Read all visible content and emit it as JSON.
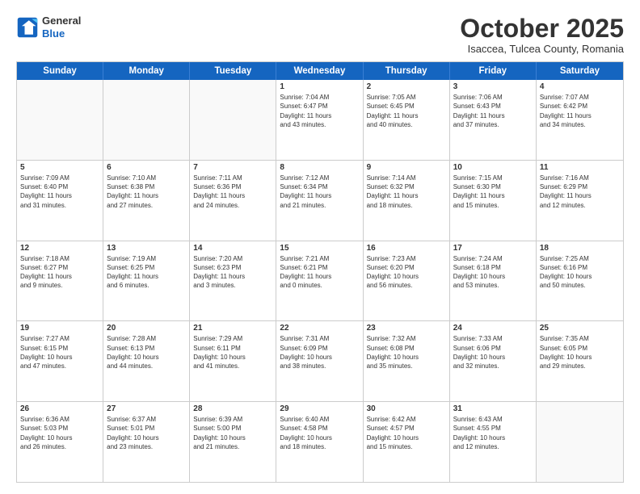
{
  "logo": {
    "general": "General",
    "blue": "Blue"
  },
  "header": {
    "month": "October 2025",
    "location": "Isaccea, Tulcea County, Romania"
  },
  "weekdays": [
    "Sunday",
    "Monday",
    "Tuesday",
    "Wednesday",
    "Thursday",
    "Friday",
    "Saturday"
  ],
  "weeks": [
    [
      {
        "day": "",
        "info": ""
      },
      {
        "day": "",
        "info": ""
      },
      {
        "day": "",
        "info": ""
      },
      {
        "day": "1",
        "info": "Sunrise: 7:04 AM\nSunset: 6:47 PM\nDaylight: 11 hours\nand 43 minutes."
      },
      {
        "day": "2",
        "info": "Sunrise: 7:05 AM\nSunset: 6:45 PM\nDaylight: 11 hours\nand 40 minutes."
      },
      {
        "day": "3",
        "info": "Sunrise: 7:06 AM\nSunset: 6:43 PM\nDaylight: 11 hours\nand 37 minutes."
      },
      {
        "day": "4",
        "info": "Sunrise: 7:07 AM\nSunset: 6:42 PM\nDaylight: 11 hours\nand 34 minutes."
      }
    ],
    [
      {
        "day": "5",
        "info": "Sunrise: 7:09 AM\nSunset: 6:40 PM\nDaylight: 11 hours\nand 31 minutes."
      },
      {
        "day": "6",
        "info": "Sunrise: 7:10 AM\nSunset: 6:38 PM\nDaylight: 11 hours\nand 27 minutes."
      },
      {
        "day": "7",
        "info": "Sunrise: 7:11 AM\nSunset: 6:36 PM\nDaylight: 11 hours\nand 24 minutes."
      },
      {
        "day": "8",
        "info": "Sunrise: 7:12 AM\nSunset: 6:34 PM\nDaylight: 11 hours\nand 21 minutes."
      },
      {
        "day": "9",
        "info": "Sunrise: 7:14 AM\nSunset: 6:32 PM\nDaylight: 11 hours\nand 18 minutes."
      },
      {
        "day": "10",
        "info": "Sunrise: 7:15 AM\nSunset: 6:30 PM\nDaylight: 11 hours\nand 15 minutes."
      },
      {
        "day": "11",
        "info": "Sunrise: 7:16 AM\nSunset: 6:29 PM\nDaylight: 11 hours\nand 12 minutes."
      }
    ],
    [
      {
        "day": "12",
        "info": "Sunrise: 7:18 AM\nSunset: 6:27 PM\nDaylight: 11 hours\nand 9 minutes."
      },
      {
        "day": "13",
        "info": "Sunrise: 7:19 AM\nSunset: 6:25 PM\nDaylight: 11 hours\nand 6 minutes."
      },
      {
        "day": "14",
        "info": "Sunrise: 7:20 AM\nSunset: 6:23 PM\nDaylight: 11 hours\nand 3 minutes."
      },
      {
        "day": "15",
        "info": "Sunrise: 7:21 AM\nSunset: 6:21 PM\nDaylight: 11 hours\nand 0 minutes."
      },
      {
        "day": "16",
        "info": "Sunrise: 7:23 AM\nSunset: 6:20 PM\nDaylight: 10 hours\nand 56 minutes."
      },
      {
        "day": "17",
        "info": "Sunrise: 7:24 AM\nSunset: 6:18 PM\nDaylight: 10 hours\nand 53 minutes."
      },
      {
        "day": "18",
        "info": "Sunrise: 7:25 AM\nSunset: 6:16 PM\nDaylight: 10 hours\nand 50 minutes."
      }
    ],
    [
      {
        "day": "19",
        "info": "Sunrise: 7:27 AM\nSunset: 6:15 PM\nDaylight: 10 hours\nand 47 minutes."
      },
      {
        "day": "20",
        "info": "Sunrise: 7:28 AM\nSunset: 6:13 PM\nDaylight: 10 hours\nand 44 minutes."
      },
      {
        "day": "21",
        "info": "Sunrise: 7:29 AM\nSunset: 6:11 PM\nDaylight: 10 hours\nand 41 minutes."
      },
      {
        "day": "22",
        "info": "Sunrise: 7:31 AM\nSunset: 6:09 PM\nDaylight: 10 hours\nand 38 minutes."
      },
      {
        "day": "23",
        "info": "Sunrise: 7:32 AM\nSunset: 6:08 PM\nDaylight: 10 hours\nand 35 minutes."
      },
      {
        "day": "24",
        "info": "Sunrise: 7:33 AM\nSunset: 6:06 PM\nDaylight: 10 hours\nand 32 minutes."
      },
      {
        "day": "25",
        "info": "Sunrise: 7:35 AM\nSunset: 6:05 PM\nDaylight: 10 hours\nand 29 minutes."
      }
    ],
    [
      {
        "day": "26",
        "info": "Sunrise: 6:36 AM\nSunset: 5:03 PM\nDaylight: 10 hours\nand 26 minutes."
      },
      {
        "day": "27",
        "info": "Sunrise: 6:37 AM\nSunset: 5:01 PM\nDaylight: 10 hours\nand 23 minutes."
      },
      {
        "day": "28",
        "info": "Sunrise: 6:39 AM\nSunset: 5:00 PM\nDaylight: 10 hours\nand 21 minutes."
      },
      {
        "day": "29",
        "info": "Sunrise: 6:40 AM\nSunset: 4:58 PM\nDaylight: 10 hours\nand 18 minutes."
      },
      {
        "day": "30",
        "info": "Sunrise: 6:42 AM\nSunset: 4:57 PM\nDaylight: 10 hours\nand 15 minutes."
      },
      {
        "day": "31",
        "info": "Sunrise: 6:43 AM\nSunset: 4:55 PM\nDaylight: 10 hours\nand 12 minutes."
      },
      {
        "day": "",
        "info": ""
      }
    ]
  ]
}
